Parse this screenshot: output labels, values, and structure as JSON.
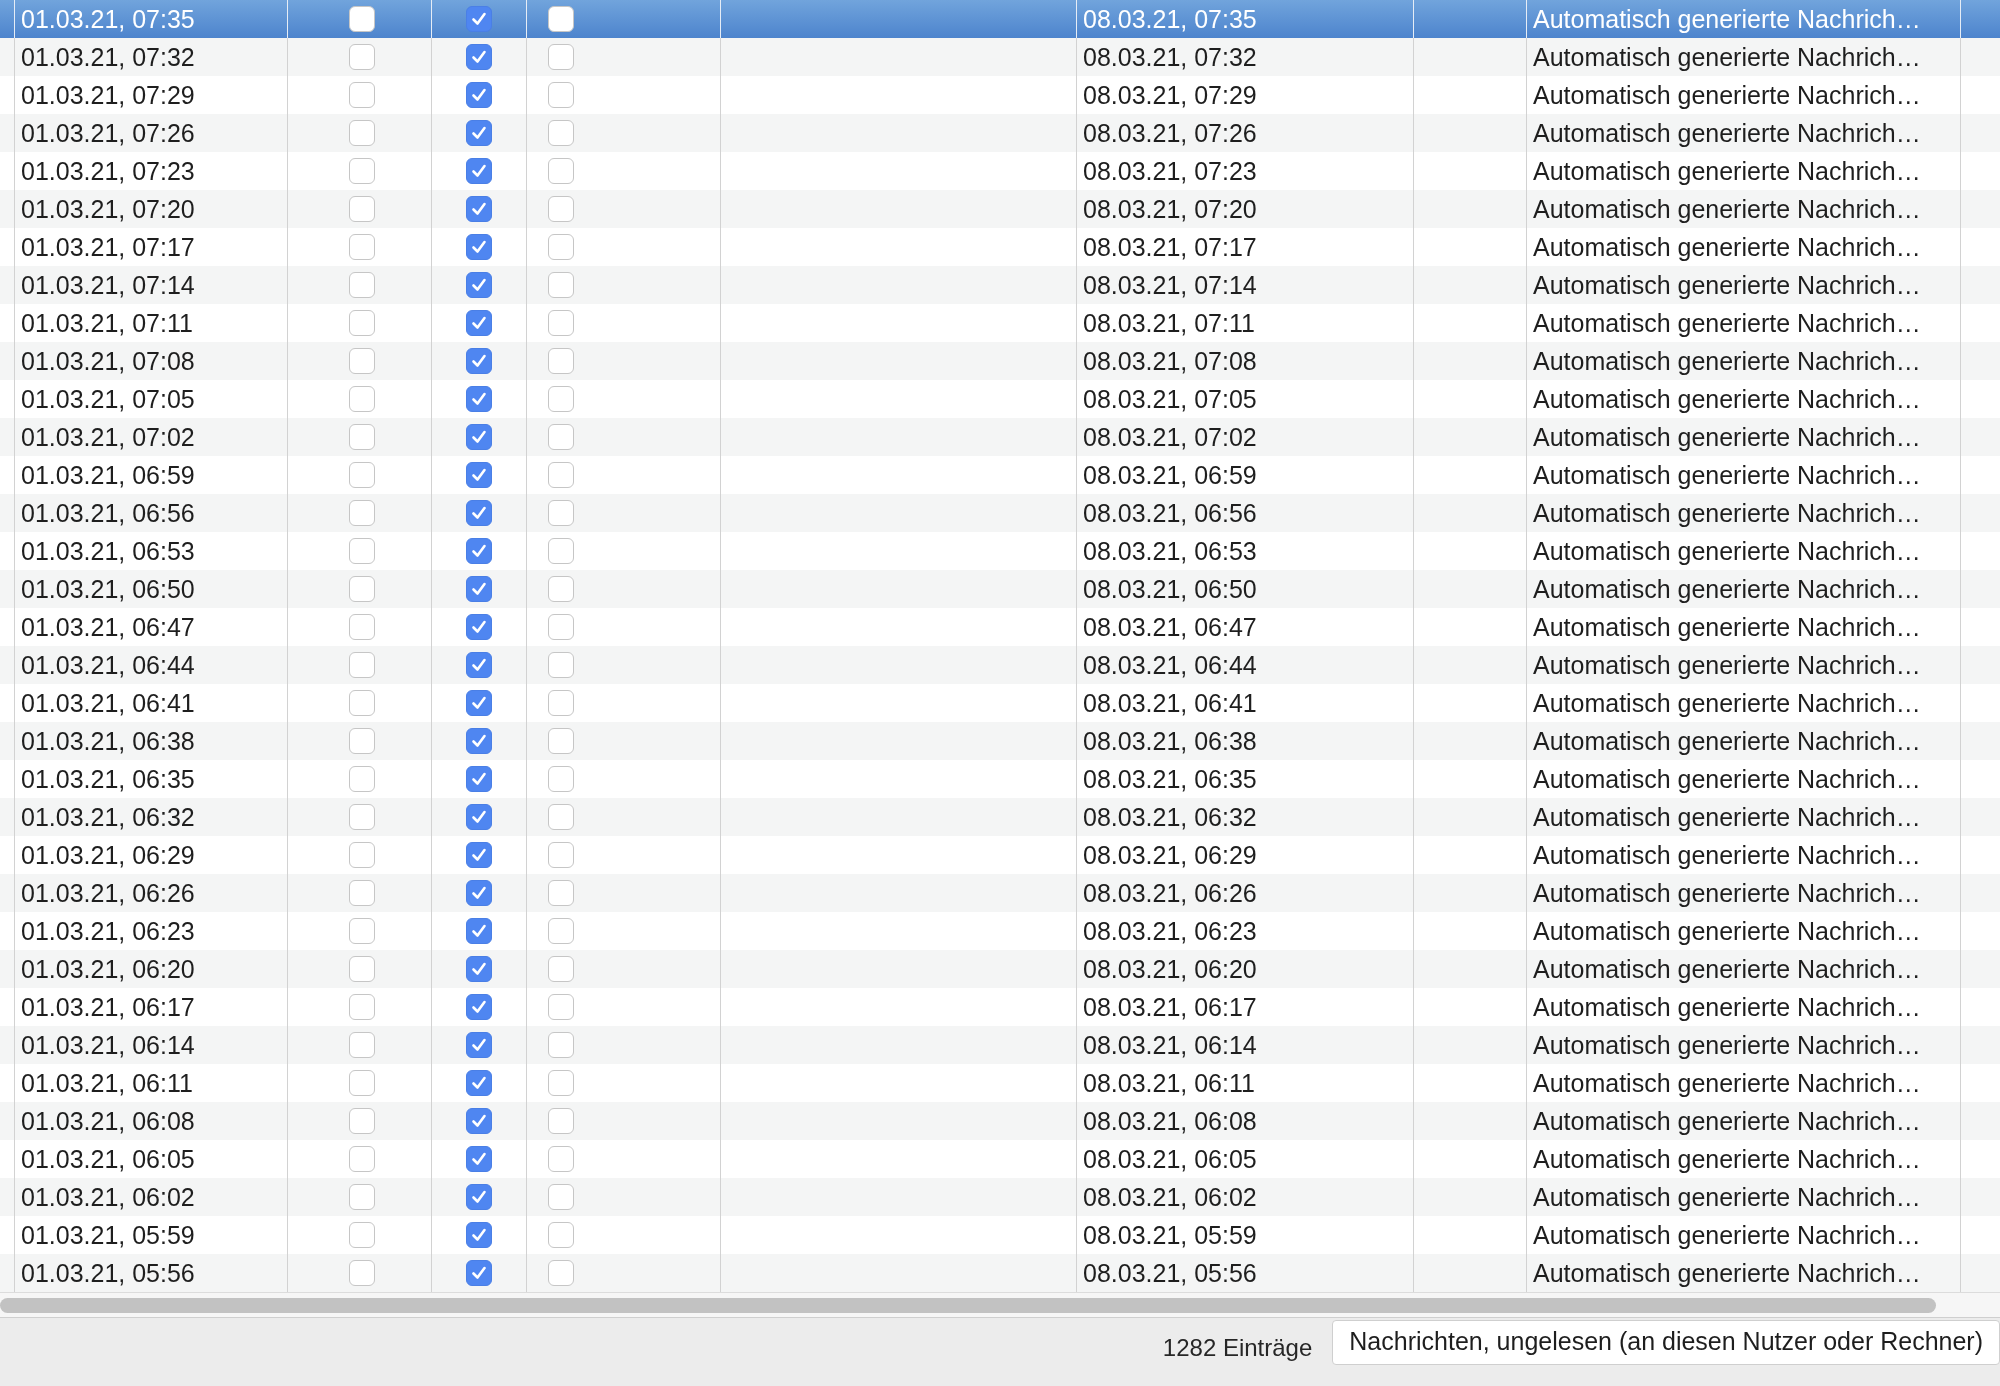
{
  "table": {
    "rows": [
      {
        "selected": true,
        "column_1": "01.03.21, 07:35",
        "checks": [
          false,
          true,
          false
        ],
        "column_6": "08.03.21, 07:35",
        "column_8": "Automatisch generierte Nachrich…"
      },
      {
        "selected": false,
        "column_1": "01.03.21, 07:32",
        "checks": [
          false,
          true,
          false
        ],
        "column_6": "08.03.21, 07:32",
        "column_8": "Automatisch generierte Nachrich…"
      },
      {
        "selected": false,
        "column_1": "01.03.21, 07:29",
        "checks": [
          false,
          true,
          false
        ],
        "column_6": "08.03.21, 07:29",
        "column_8": "Automatisch generierte Nachrich…"
      },
      {
        "selected": false,
        "column_1": "01.03.21, 07:26",
        "checks": [
          false,
          true,
          false
        ],
        "column_6": "08.03.21, 07:26",
        "column_8": "Automatisch generierte Nachrich…"
      },
      {
        "selected": false,
        "column_1": "01.03.21, 07:23",
        "checks": [
          false,
          true,
          false
        ],
        "column_6": "08.03.21, 07:23",
        "column_8": "Automatisch generierte Nachrich…"
      },
      {
        "selected": false,
        "column_1": "01.03.21, 07:20",
        "checks": [
          false,
          true,
          false
        ],
        "column_6": "08.03.21, 07:20",
        "column_8": "Automatisch generierte Nachrich…"
      },
      {
        "selected": false,
        "column_1": "01.03.21, 07:17",
        "checks": [
          false,
          true,
          false
        ],
        "column_6": "08.03.21, 07:17",
        "column_8": "Automatisch generierte Nachrich…"
      },
      {
        "selected": false,
        "column_1": "01.03.21, 07:14",
        "checks": [
          false,
          true,
          false
        ],
        "column_6": "08.03.21, 07:14",
        "column_8": "Automatisch generierte Nachrich…"
      },
      {
        "selected": false,
        "column_1": "01.03.21, 07:11",
        "checks": [
          false,
          true,
          false
        ],
        "column_6": "08.03.21, 07:11",
        "column_8": "Automatisch generierte Nachrich…"
      },
      {
        "selected": false,
        "column_1": "01.03.21, 07:08",
        "checks": [
          false,
          true,
          false
        ],
        "column_6": "08.03.21, 07:08",
        "column_8": "Automatisch generierte Nachrich…"
      },
      {
        "selected": false,
        "column_1": "01.03.21, 07:05",
        "checks": [
          false,
          true,
          false
        ],
        "column_6": "08.03.21, 07:05",
        "column_8": "Automatisch generierte Nachrich…"
      },
      {
        "selected": false,
        "column_1": "01.03.21, 07:02",
        "checks": [
          false,
          true,
          false
        ],
        "column_6": "08.03.21, 07:02",
        "column_8": "Automatisch generierte Nachrich…"
      },
      {
        "selected": false,
        "column_1": "01.03.21, 06:59",
        "checks": [
          false,
          true,
          false
        ],
        "column_6": "08.03.21, 06:59",
        "column_8": "Automatisch generierte Nachrich…"
      },
      {
        "selected": false,
        "column_1": "01.03.21, 06:56",
        "checks": [
          false,
          true,
          false
        ],
        "column_6": "08.03.21, 06:56",
        "column_8": "Automatisch generierte Nachrich…"
      },
      {
        "selected": false,
        "column_1": "01.03.21, 06:53",
        "checks": [
          false,
          true,
          false
        ],
        "column_6": "08.03.21, 06:53",
        "column_8": "Automatisch generierte Nachrich…"
      },
      {
        "selected": false,
        "column_1": "01.03.21, 06:50",
        "checks": [
          false,
          true,
          false
        ],
        "column_6": "08.03.21, 06:50",
        "column_8": "Automatisch generierte Nachrich…"
      },
      {
        "selected": false,
        "column_1": "01.03.21, 06:47",
        "checks": [
          false,
          true,
          false
        ],
        "column_6": "08.03.21, 06:47",
        "column_8": "Automatisch generierte Nachrich…"
      },
      {
        "selected": false,
        "column_1": "01.03.21, 06:44",
        "checks": [
          false,
          true,
          false
        ],
        "column_6": "08.03.21, 06:44",
        "column_8": "Automatisch generierte Nachrich…"
      },
      {
        "selected": false,
        "column_1": "01.03.21, 06:41",
        "checks": [
          false,
          true,
          false
        ],
        "column_6": "08.03.21, 06:41",
        "column_8": "Automatisch generierte Nachrich…"
      },
      {
        "selected": false,
        "column_1": "01.03.21, 06:38",
        "checks": [
          false,
          true,
          false
        ],
        "column_6": "08.03.21, 06:38",
        "column_8": "Automatisch generierte Nachrich…"
      },
      {
        "selected": false,
        "column_1": "01.03.21, 06:35",
        "checks": [
          false,
          true,
          false
        ],
        "column_6": "08.03.21, 06:35",
        "column_8": "Automatisch generierte Nachrich…"
      },
      {
        "selected": false,
        "column_1": "01.03.21, 06:32",
        "checks": [
          false,
          true,
          false
        ],
        "column_6": "08.03.21, 06:32",
        "column_8": "Automatisch generierte Nachrich…"
      },
      {
        "selected": false,
        "column_1": "01.03.21, 06:29",
        "checks": [
          false,
          true,
          false
        ],
        "column_6": "08.03.21, 06:29",
        "column_8": "Automatisch generierte Nachrich…"
      },
      {
        "selected": false,
        "column_1": "01.03.21, 06:26",
        "checks": [
          false,
          true,
          false
        ],
        "column_6": "08.03.21, 06:26",
        "column_8": "Automatisch generierte Nachrich…"
      },
      {
        "selected": false,
        "column_1": "01.03.21, 06:23",
        "checks": [
          false,
          true,
          false
        ],
        "column_6": "08.03.21, 06:23",
        "column_8": "Automatisch generierte Nachrich…"
      },
      {
        "selected": false,
        "column_1": "01.03.21, 06:20",
        "checks": [
          false,
          true,
          false
        ],
        "column_6": "08.03.21, 06:20",
        "column_8": "Automatisch generierte Nachrich…"
      },
      {
        "selected": false,
        "column_1": "01.03.21, 06:17",
        "checks": [
          false,
          true,
          false
        ],
        "column_6": "08.03.21, 06:17",
        "column_8": "Automatisch generierte Nachrich…"
      },
      {
        "selected": false,
        "column_1": "01.03.21, 06:14",
        "checks": [
          false,
          true,
          false
        ],
        "column_6": "08.03.21, 06:14",
        "column_8": "Automatisch generierte Nachrich…"
      },
      {
        "selected": false,
        "column_1": "01.03.21, 06:11",
        "checks": [
          false,
          true,
          false
        ],
        "column_6": "08.03.21, 06:11",
        "column_8": "Automatisch generierte Nachrich…"
      },
      {
        "selected": false,
        "column_1": "01.03.21, 06:08",
        "checks": [
          false,
          true,
          false
        ],
        "column_6": "08.03.21, 06:08",
        "column_8": "Automatisch generierte Nachrich…"
      },
      {
        "selected": false,
        "column_1": "01.03.21, 06:05",
        "checks": [
          false,
          true,
          false
        ],
        "column_6": "08.03.21, 06:05",
        "column_8": "Automatisch generierte Nachrich…"
      },
      {
        "selected": false,
        "column_1": "01.03.21, 06:02",
        "checks": [
          false,
          true,
          false
        ],
        "column_6": "08.03.21, 06:02",
        "column_8": "Automatisch generierte Nachrich…"
      },
      {
        "selected": false,
        "column_1": "01.03.21, 05:59",
        "checks": [
          false,
          true,
          false
        ],
        "column_6": "08.03.21, 05:59",
        "column_8": "Automatisch generierte Nachrich…"
      },
      {
        "selected": false,
        "column_1": "01.03.21, 05:56",
        "checks": [
          false,
          true,
          false
        ],
        "column_6": "08.03.21, 05:56",
        "column_8": "Automatisch generierte Nachrich…"
      }
    ]
  },
  "status_bar": {
    "count": "1282 Einträge",
    "filter": "Nachrichten, ungelesen (an diesen Nutzer oder Rechner)"
  }
}
